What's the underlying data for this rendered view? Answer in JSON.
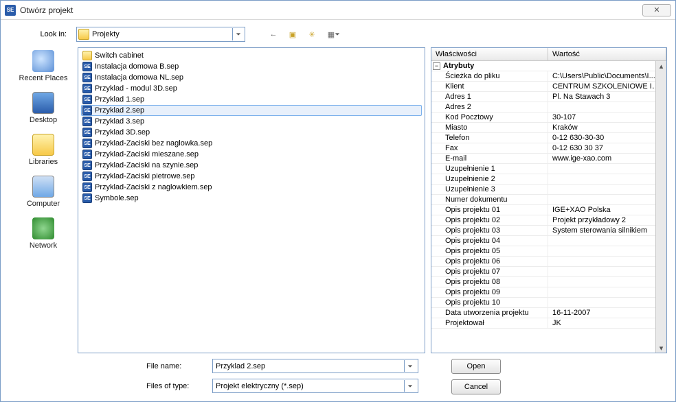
{
  "window": {
    "title": "Otwórz projekt",
    "close_glyph": "✕"
  },
  "toolbar": {
    "lookin_label": "Look in:",
    "lookin_value": "Projekty"
  },
  "places": [
    {
      "name": "recent",
      "label": "Recent Places",
      "icon_class": "ico-recent"
    },
    {
      "name": "desktop",
      "label": "Desktop",
      "icon_class": "ico-desktop"
    },
    {
      "name": "libraries",
      "label": "Libraries",
      "icon_class": "ico-lib"
    },
    {
      "name": "computer",
      "label": "Computer",
      "icon_class": "ico-comp"
    },
    {
      "name": "network",
      "label": "Network",
      "icon_class": "ico-net"
    }
  ],
  "files": [
    {
      "name": "Switch cabinet",
      "type": "folder"
    },
    {
      "name": "Instalacja domowa B.sep",
      "type": "sep"
    },
    {
      "name": "Instalacja domowa NL.sep",
      "type": "sep"
    },
    {
      "name": "Przyklad - modul 3D.sep",
      "type": "sep"
    },
    {
      "name": "Przyklad 1.sep",
      "type": "sep"
    },
    {
      "name": "Przyklad 2.sep",
      "type": "sep",
      "selected": true
    },
    {
      "name": "Przyklad 3.sep",
      "type": "sep"
    },
    {
      "name": "Przyklad 3D.sep",
      "type": "sep"
    },
    {
      "name": "Przyklad-Zaciski bez naglowka.sep",
      "type": "sep"
    },
    {
      "name": "Przyklad-Zaciski mieszane.sep",
      "type": "sep"
    },
    {
      "name": "Przyklad-Zaciski na szynie.sep",
      "type": "sep"
    },
    {
      "name": "Przyklad-Zaciski pietrowe.sep",
      "type": "sep"
    },
    {
      "name": "Przyklad-Zaciski z naglowkiem.sep",
      "type": "sep"
    },
    {
      "name": "Symbole.sep",
      "type": "sep"
    }
  ],
  "props": {
    "header_left": "Właściwości",
    "header_right": "Wartość",
    "group_label": "Atrybuty",
    "rows": [
      {
        "k": "Ścieżka do pliku",
        "v": "C:\\Users\\Public\\Documents\\I..."
      },
      {
        "k": "Klient",
        "v": "CENTRUM SZKOLENIOWE IG..."
      },
      {
        "k": "Adres 1",
        "v": "Pl. Na Stawach 3"
      },
      {
        "k": "Adres 2",
        "v": ""
      },
      {
        "k": "Kod Pocztowy",
        "v": "30-107"
      },
      {
        "k": "Miasto",
        "v": " Kraków"
      },
      {
        "k": "Telefon",
        "v": "0-12 630-30-30"
      },
      {
        "k": "Fax",
        "v": "0-12 630 30 37"
      },
      {
        "k": "E-mail",
        "v": "www.ige-xao.com"
      },
      {
        "k": "Uzupełnienie 1",
        "v": ""
      },
      {
        "k": "Uzupełnienie 2",
        "v": ""
      },
      {
        "k": "Uzupełnienie 3",
        "v": ""
      },
      {
        "k": "Numer dokumentu",
        "v": ""
      },
      {
        "k": "Opis projektu 01",
        "v": "IGE+XAO Polska"
      },
      {
        "k": "Opis projektu 02",
        "v": "Projekt przykładowy 2"
      },
      {
        "k": "Opis projektu 03",
        "v": "System sterowania silnikiem"
      },
      {
        "k": "Opis projektu 04",
        "v": ""
      },
      {
        "k": "Opis projektu 05",
        "v": ""
      },
      {
        "k": "Opis projektu 06",
        "v": ""
      },
      {
        "k": "Opis projektu 07",
        "v": ""
      },
      {
        "k": "Opis projektu 08",
        "v": ""
      },
      {
        "k": "Opis projektu 09",
        "v": ""
      },
      {
        "k": "Opis projektu 10",
        "v": ""
      },
      {
        "k": "Data utworzenia projektu",
        "v": "16-11-2007"
      },
      {
        "k": "Projektował",
        "v": "JK"
      }
    ]
  },
  "form": {
    "filename_label": "File name:",
    "filename_value": "Przyklad 2.sep",
    "filetype_label": "Files of type:",
    "filetype_value": "Projekt elektryczny (*.sep)"
  },
  "buttons": {
    "open": "Open",
    "cancel": "Cancel"
  }
}
